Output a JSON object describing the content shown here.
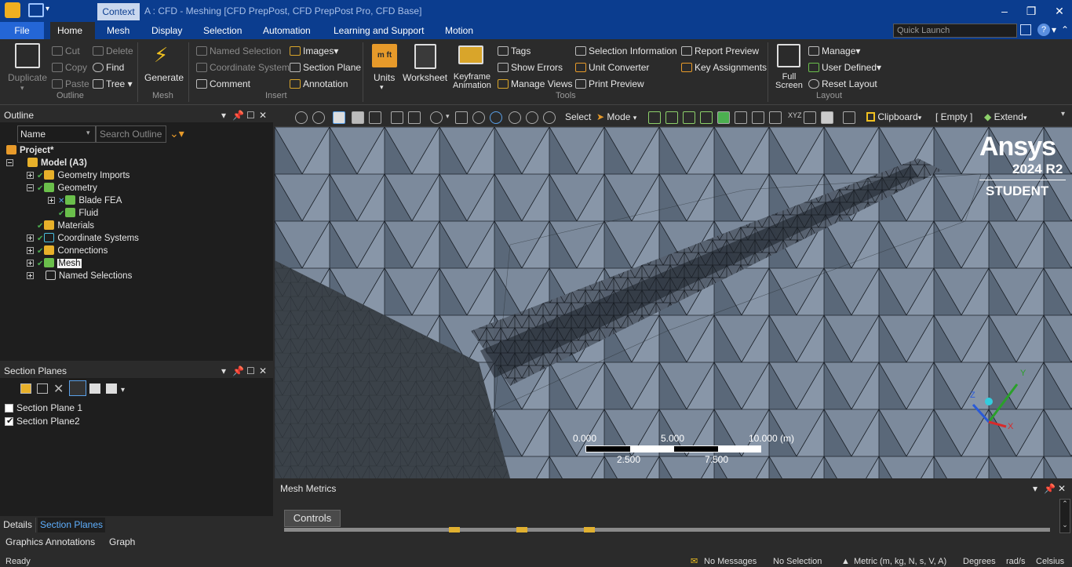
{
  "titlebar": {
    "context_tab": "Context",
    "title": "A : CFD - Meshing [CFD PrepPost, CFD PrepPost Pro, CFD Base]",
    "buttons": [
      "minimize",
      "restore",
      "close"
    ]
  },
  "tabs": {
    "file": "File",
    "items": [
      "Home",
      "Mesh",
      "Display",
      "Selection",
      "Automation",
      "Learning and Support",
      "Motion"
    ],
    "active": "Home"
  },
  "quick_launch": {
    "placeholder": "Quick Launch"
  },
  "ribbon": {
    "outline": {
      "duplicate": "Duplicate",
      "cut": "Cut",
      "copy": "Copy",
      "paste": "Paste",
      "delete": "Delete",
      "find": "Find",
      "tree": "Tree",
      "group": "Outline"
    },
    "mesh": {
      "generate": "Generate",
      "group": "Mesh"
    },
    "insert": {
      "named_selection": "Named Selection",
      "coordinate_system": "Coordinate System",
      "comment": "Comment",
      "images": "Images",
      "section_plane": "Section Plane",
      "annotation": "Annotation",
      "group": "Insert"
    },
    "tools": {
      "units": "Units",
      "worksheet": "Worksheet",
      "keyframe_1": "Keyframe",
      "keyframe_2": "Animation",
      "tags": "Tags",
      "show_errors": "Show Errors",
      "manage_views": "Manage Views",
      "selection_information": "Selection Information",
      "unit_converter": "Unit Converter",
      "print_preview": "Print Preview",
      "report_preview": "Report Preview",
      "key_assignments": "Key Assignments",
      "group": "Tools"
    },
    "layout": {
      "full_1": "Full",
      "full_2": "Screen",
      "manage": "Manage",
      "user_defined": "User Defined",
      "reset_layout": "Reset Layout",
      "group": "Layout"
    }
  },
  "outline_panel": {
    "title": "Outline",
    "filter": "Name",
    "search_placeholder": "Search Outline",
    "tree": [
      "Project*",
      "Model (A3)",
      "Geometry Imports",
      "Geometry",
      "Blade FEA",
      "Fluid",
      "Materials",
      "Coordinate Systems",
      "Connections",
      "Mesh",
      "Named Selections"
    ]
  },
  "section_panel": {
    "title": "Section Planes",
    "items": [
      {
        "label": "Section Plane 1",
        "checked": false
      },
      {
        "label": "Section Plane2",
        "checked": true
      }
    ]
  },
  "bottom_tabs": {
    "details": "Details",
    "section_planes": "Section Planes",
    "graphics_annotations": "Graphics Annotations",
    "graph": "Graph"
  },
  "viewport_toolbar": {
    "select": "Select",
    "mode": "Mode",
    "clipboard": "Clipboard",
    "clipboard_value": "[ Empty ]",
    "extend": "Extend"
  },
  "viewport": {
    "brand": "Ansys",
    "version": "2024 R2",
    "edition": "STUDENT",
    "scale": {
      "ticks_top": [
        "0.000",
        "5.000",
        "10.000 (m)"
      ],
      "ticks_bottom": [
        "2.500",
        "7.500"
      ]
    },
    "triad": {
      "x": "X",
      "y": "Y",
      "z": "Z"
    }
  },
  "metrics": {
    "title": "Mesh Metrics",
    "controls": "Controls"
  },
  "status": {
    "ready": "Ready",
    "messages": "No Messages",
    "selection": "No Selection",
    "units": "Metric (m, kg, N, s, V, A)",
    "angle": "Degrees",
    "angular_velocity": "rad/s",
    "temperature": "Celsius"
  },
  "colors": {
    "titlebar": "#0b3d8f",
    "file_tab": "#2466d6",
    "panel": "#1e1e1e",
    "mesh_bg": "#5f6e80",
    "accent_orange": "#f0b020"
  }
}
